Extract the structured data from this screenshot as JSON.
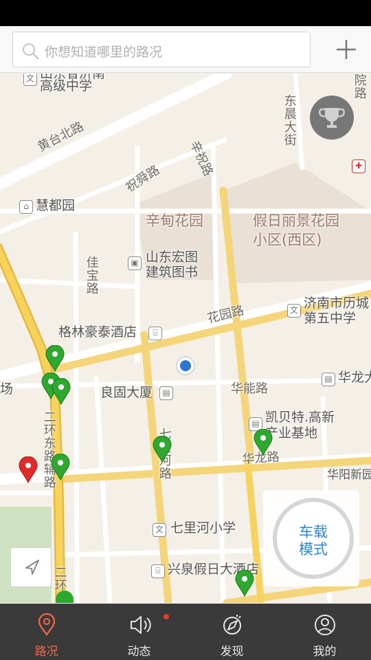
{
  "search": {
    "placeholder": "你想知道哪里的路况"
  },
  "map": {
    "labels": {
      "school_partial": "山东省济南",
      "high_school": "高级中学",
      "huangtai_rd": "黄台北路",
      "zhushun_rd": "祝舜路",
      "xinzhu_rd": "辛祝路",
      "dongchen_st": "东晨大街",
      "yuan_rd": "院路",
      "huidu_garden": "慧都园",
      "xindian_garden": "辛甸花园",
      "jiari_1": "假日丽景花园",
      "jiari_2": "小区(西区)",
      "shandong_1": "山东宏图",
      "shandong_2": "建筑图书",
      "jiabao_rd": "佳宝路",
      "huayuan_rd": "花园路",
      "licheng_1": "济南市历城",
      "licheng_2": "第五中学",
      "gelin_hotel": "格林豪泰酒店",
      "lianggu": "良固大厦",
      "huaneng_rd": "华能路",
      "hualong_bldg": "华龙大",
      "kaibeite_1": "凯贝特.高新",
      "kaibeite_2": "产业基地",
      "erhuan_east": "二环东路辅路",
      "qili_rd": "七里河路",
      "hualong_rd": "华龙路",
      "huayang": "华阳新园",
      "qilihe_school": "七里河小学",
      "xingquan_hotel": "兴泉假日大酒店",
      "chang_partial": "场",
      "erhuan_bottom": "二环"
    },
    "car_mode": {
      "line1": "车载",
      "line2": "模式"
    }
  },
  "nav": [
    {
      "label": "路况",
      "icon": "location-pin-icon",
      "active": true
    },
    {
      "label": "动态",
      "icon": "speaker-icon",
      "active": false,
      "badge": true
    },
    {
      "label": "发现",
      "icon": "compass-icon",
      "active": false
    },
    {
      "label": "我的",
      "icon": "user-icon",
      "active": false
    }
  ],
  "colors": {
    "accent": "#f26a4b",
    "pin_green": "#2ea82e",
    "pin_red": "#e02b2b",
    "nav_bg": "#3a3a3a",
    "highway": "#f3cf57",
    "blue_dot": "#2f74d0"
  }
}
